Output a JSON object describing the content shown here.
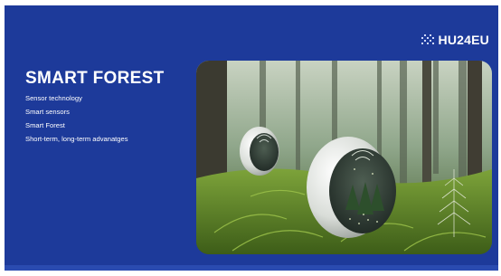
{
  "slide": {
    "logo": {
      "text": "HU24EU",
      "icon": "logo-mark-icon"
    },
    "title": "SMART FOREST",
    "bullets": [
      "Sensor technology",
      "Smart sensors",
      "Smart Forest",
      "Short-term, long-term advanatges"
    ],
    "image": {
      "subject": "smart forest sensor devices in fern-covered forest"
    }
  },
  "colors": {
    "background": "#1d3a9a",
    "text": "#ffffff",
    "moss": "#6f9a2a"
  }
}
